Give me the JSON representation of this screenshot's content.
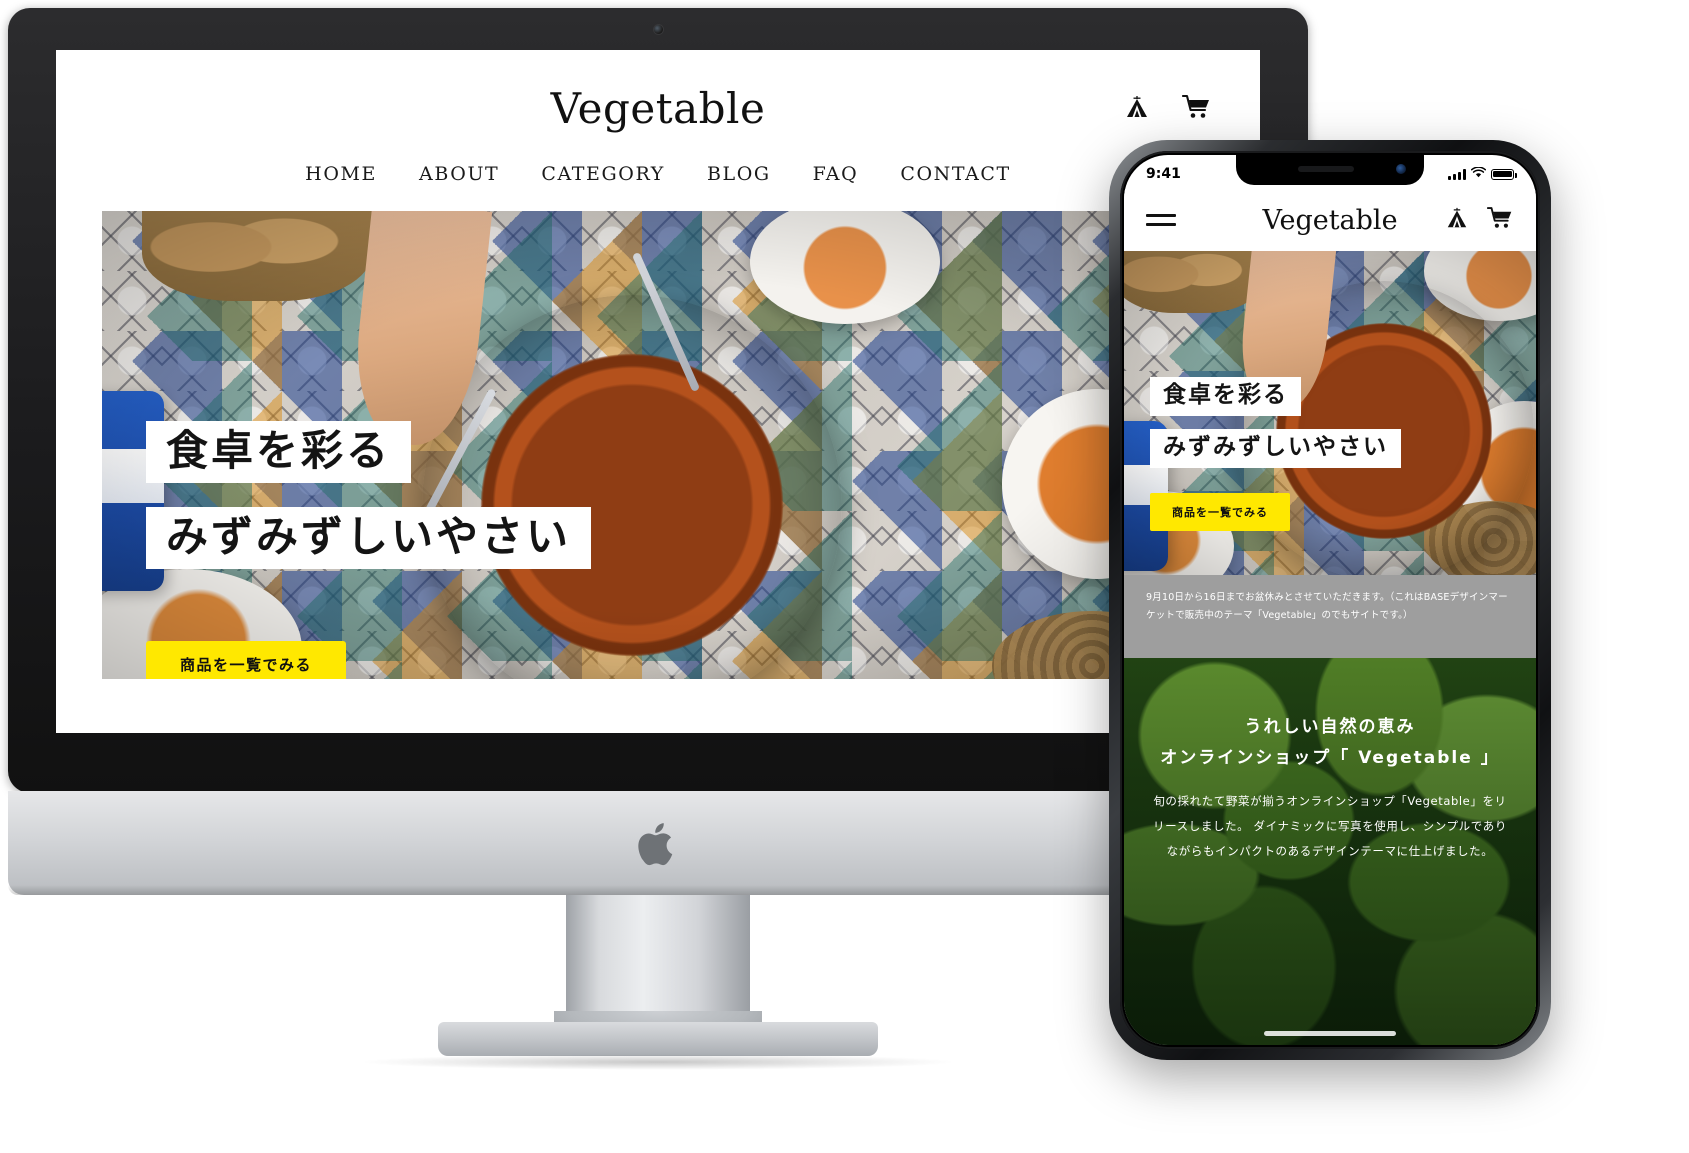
{
  "desktop": {
    "brand": "Vegetable",
    "nav": [
      "HOME",
      "ABOUT",
      "CATEGORY",
      "BLOG",
      "FAQ",
      "CONTACT"
    ],
    "icons": {
      "tent": "tent-icon",
      "cart": "cart-icon"
    },
    "hero": {
      "line1": "食卓を彩る",
      "line2": "みずみずしいやさい",
      "cta": "商品を一覧でみる"
    }
  },
  "phone": {
    "status": {
      "time": "9:41",
      "signal": "signal-icon",
      "wifi": "wifi-icon",
      "battery": "battery-icon"
    },
    "brand": "Vegetable",
    "menu_icon": "hamburger-icon",
    "icons": {
      "tent": "tent-icon",
      "cart": "cart-icon"
    },
    "hero": {
      "line1": "食卓を彩る",
      "line2": "みずみずしいやさい",
      "cta": "商品を一覧でみる"
    },
    "notice": "9月10日から16日までお盆休みとさせていただきます。（これはBASEデザインマーケットで販売中のテーマ「Vegetable」のでもサイトです。）",
    "green_section": {
      "heading1": "うれしい自然の恵み",
      "heading2": "オンラインショップ「 Vegetable 」",
      "body": "旬の採れたて野菜が揃うオンラインショップ「Vegetable」をリリースしました。\nダイナミックに写真を使用し、シンプルでありながらもインパクトのあるデザインテーマに仕上げました。"
    }
  },
  "colors": {
    "accent_yellow": "#ffe800",
    "notice_gray": "#9e9e9e",
    "text_dark": "#111111"
  }
}
